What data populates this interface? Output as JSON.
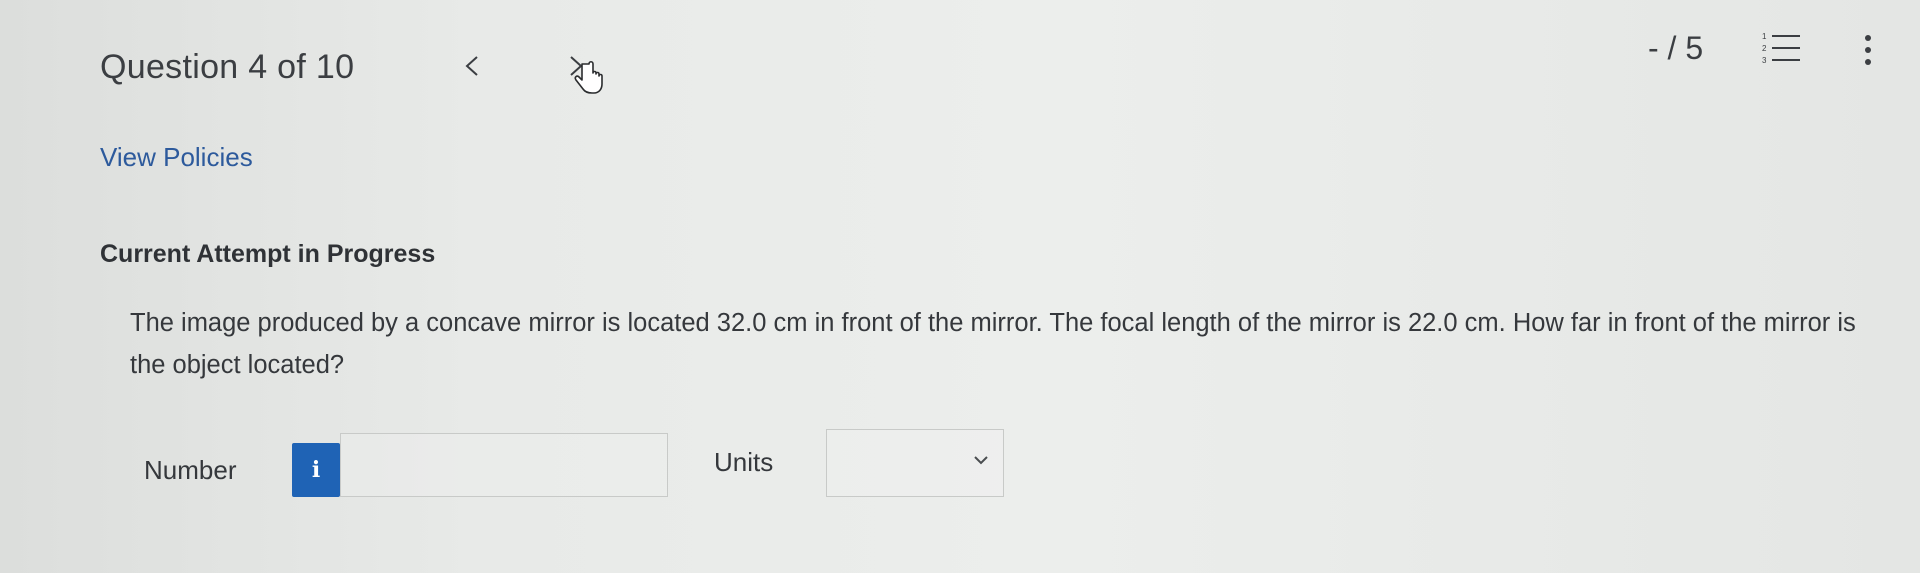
{
  "header": {
    "question_label": "Question 4 of 10",
    "score": "- / 5",
    "prev_icon": "chevron-left-icon",
    "next_icon": "chevron-right-icon",
    "list_icon": "numbered-list-icon",
    "menu_icon": "kebab-menu-icon"
  },
  "links": {
    "view_policies": "View Policies"
  },
  "attempt": {
    "heading": "Current Attempt in Progress"
  },
  "question": {
    "text": "The image produced by a concave mirror is located 32.0 cm in front of the mirror. The focal length of the mirror is 22.0 cm. How far in front of the mirror is the object located?"
  },
  "answer": {
    "number_label": "Number",
    "info_glyph": "i",
    "number_value": "",
    "units_label": "Units",
    "units_value": ""
  },
  "colors": {
    "link": "#2d5a9c",
    "info_button": "#1f63b5",
    "text": "#3b3e42"
  }
}
